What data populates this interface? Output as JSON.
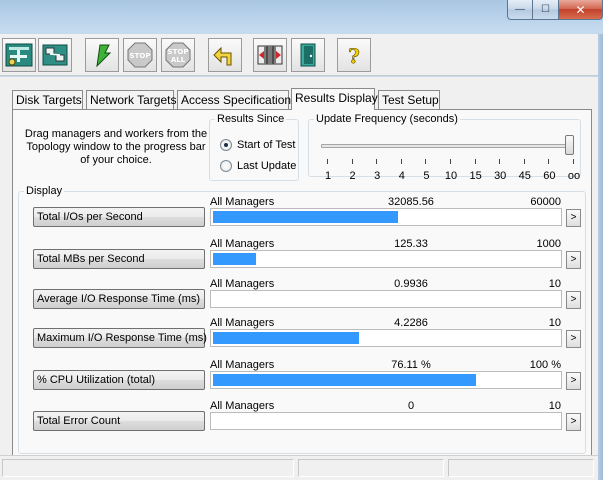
{
  "window": {
    "controls": {
      "minimize": "—",
      "maximize": "☐",
      "close": "✕"
    }
  },
  "toolbar": {
    "buttons": [
      {
        "name": "topology-icon"
      },
      {
        "name": "network-icon"
      },
      {
        "name": "start-test-icon"
      },
      {
        "name": "stop-icon",
        "label": "STOP"
      },
      {
        "name": "stop-all-icon",
        "label1": "STOP",
        "label2": "ALL"
      },
      {
        "name": "reset-icon"
      },
      {
        "name": "new-manager-icon"
      },
      {
        "name": "exit-icon"
      },
      {
        "name": "help-icon",
        "label": "?"
      }
    ]
  },
  "tabs": [
    "Disk Targets",
    "Network Targets",
    "Access Specifications",
    "Results Display",
    "Test Setup"
  ],
  "active_tab": "Results Display",
  "hint_text": "Drag managers and workers from the Topology window to the progress bar of your choice.",
  "results_since": {
    "legend": "Results Since",
    "options": [
      "Start of Test",
      "Last Update"
    ],
    "selected": "Start of Test"
  },
  "update_frequency": {
    "legend": "Update Frequency (seconds)",
    "ticks": [
      "1",
      "2",
      "3",
      "4",
      "5",
      "10",
      "15",
      "30",
      "45",
      "60",
      "oo"
    ],
    "selected": "oo"
  },
  "display": {
    "legend": "Display",
    "rows": [
      {
        "label": "Total I/Os per Second",
        "scope": "All Managers",
        "value": "32085.56",
        "max": "60000",
        "fill": 0.535,
        "arrow": ">"
      },
      {
        "label": "Total MBs per Second",
        "scope": "All Managers",
        "value": "125.33",
        "max": "1000",
        "fill": 0.125,
        "arrow": ">"
      },
      {
        "label": "Average I/O Response Time (ms)",
        "scope": "All Managers",
        "value": "0.9936",
        "max": "10",
        "fill": 0.0,
        "arrow": ">"
      },
      {
        "label": "Maximum I/O Response Time (ms)",
        "scope": "All Managers",
        "value": "4.2286",
        "max": "10",
        "fill": 0.4229,
        "arrow": ">"
      },
      {
        "label": "% CPU Utilization (total)",
        "scope": "All Managers",
        "value": "76.11 %",
        "max": "100 %",
        "fill": 0.7611,
        "arrow": ">"
      },
      {
        "label": "Total Error Count",
        "scope": "All Managers",
        "value": "0",
        "max": "10",
        "fill": 0.0,
        "arrow": ">"
      }
    ]
  },
  "colors": {
    "bar_fill": "#3399ff",
    "frame": "#b6cfe8"
  }
}
